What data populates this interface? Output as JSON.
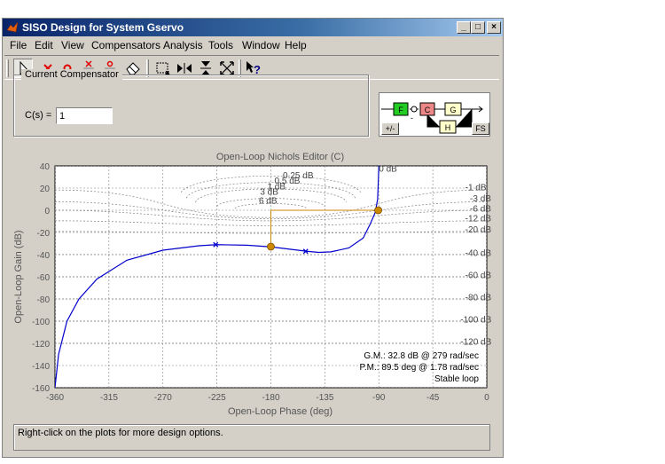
{
  "window": {
    "title": "SISO Design for System Gservo",
    "minimize": "_",
    "maximize": "□",
    "close": "×"
  },
  "menu": [
    "File",
    "Edit",
    "View",
    "Compensators",
    "Analysis",
    "Tools",
    "Window",
    "Help"
  ],
  "toolbar": [
    "select-arrow-icon",
    "delete-x-icon",
    "add-zero-icon",
    "add-complex-poles-icon",
    "add-complex-zeros-icon",
    "eraser-icon",
    "zoom-box-icon",
    "zoom-x-icon",
    "zoom-y-icon",
    "fit-icon",
    "context-help-icon"
  ],
  "compensator": {
    "group_label": "Current Compensator",
    "cs_label": "C(s) =",
    "cs_value": "1"
  },
  "diagram": {
    "blocks": [
      "F",
      "C",
      "G",
      "H"
    ],
    "sign": "-",
    "pm_button": "+/-",
    "fs_button": "FS"
  },
  "plot": {
    "title": "Open-Loop Nichols Editor (C)",
    "xlabel": "Open-Loop Phase (deg)",
    "ylabel": "Open-Loop Gain (dB)",
    "xticks": [
      -360,
      -315,
      -270,
      -225,
      -180,
      -135,
      -90,
      -45,
      0
    ],
    "yticks": [
      40,
      20,
      0,
      -20,
      -40,
      -60,
      -80,
      -100,
      -120,
      -140,
      -160
    ],
    "contours": [
      {
        "text": "0 dB",
        "x": -90,
        "y": 35
      },
      {
        "text": "0.25 dB",
        "x": -170,
        "y": 29
      },
      {
        "text": "0.5 dB",
        "x": -177,
        "y": 24
      },
      {
        "text": "1 dB",
        "x": -183,
        "y": 19
      },
      {
        "text": "3 dB",
        "x": -189,
        "y": 14
      },
      {
        "text": "6 dB",
        "x": -190,
        "y": 6
      },
      {
        "text": "-1 dB",
        "x": -18,
        "y": 18
      },
      {
        "text": "-3 dB",
        "x": -14,
        "y": 8
      },
      {
        "text": "-6 dB",
        "x": -14,
        "y": -1
      },
      {
        "text": "-12 dB",
        "x": -18,
        "y": -10
      },
      {
        "text": "-20 dB",
        "x": -18,
        "y": -20
      },
      {
        "text": "-40 dB",
        "x": -18,
        "y": -41
      },
      {
        "text": "-60 dB",
        "x": -18,
        "y": -61
      },
      {
        "text": "-80 dB",
        "x": -18,
        "y": -81
      },
      {
        "text": "-100 dB",
        "x": -22,
        "y": -101
      },
      {
        "text": "-120 dB",
        "x": -22,
        "y": -121
      }
    ],
    "margins": {
      "gm": "G.M.: 32.8 dB @ 279 rad/sec",
      "pm": "P.M.: 89.5 deg @ 1.78 rad/sec",
      "stable": "Stable loop"
    },
    "colors": {
      "response": "#0000cc",
      "marker": "#cc8800",
      "grid": "#808080"
    }
  },
  "chart_data": {
    "type": "line",
    "title": "Open-Loop Nichols Editor (C)",
    "xlabel": "Open-Loop Phase (deg)",
    "ylabel": "Open-Loop Gain (dB)",
    "xlim": [
      -360,
      0
    ],
    "ylim": [
      -160,
      40
    ],
    "series": [
      {
        "x": [
          -360,
          -357,
          -350,
          -340,
          -325,
          -300,
          -270,
          -240,
          -225,
          -200,
          -180,
          -165,
          -150,
          -140,
          -130,
          -115,
          -103,
          -97,
          -93,
          -91,
          -90.3,
          -90
        ],
        "y": [
          -160,
          -130,
          -100,
          -80,
          -62,
          -45,
          -36,
          -32,
          -31,
          -31.5,
          -33,
          -35,
          -37,
          -38,
          -37.5,
          -34,
          -25,
          -12,
          -2,
          10,
          30,
          40
        ]
      }
    ],
    "pole_markers": [
      {
        "x": -226,
        "y": -31
      },
      {
        "x": -151,
        "y": -37
      }
    ],
    "margin_points": [
      {
        "x": -180,
        "y": -32.8
      },
      {
        "x": -90.5,
        "y": 0
      }
    ]
  },
  "status": "Right-click on the plots for more design options."
}
